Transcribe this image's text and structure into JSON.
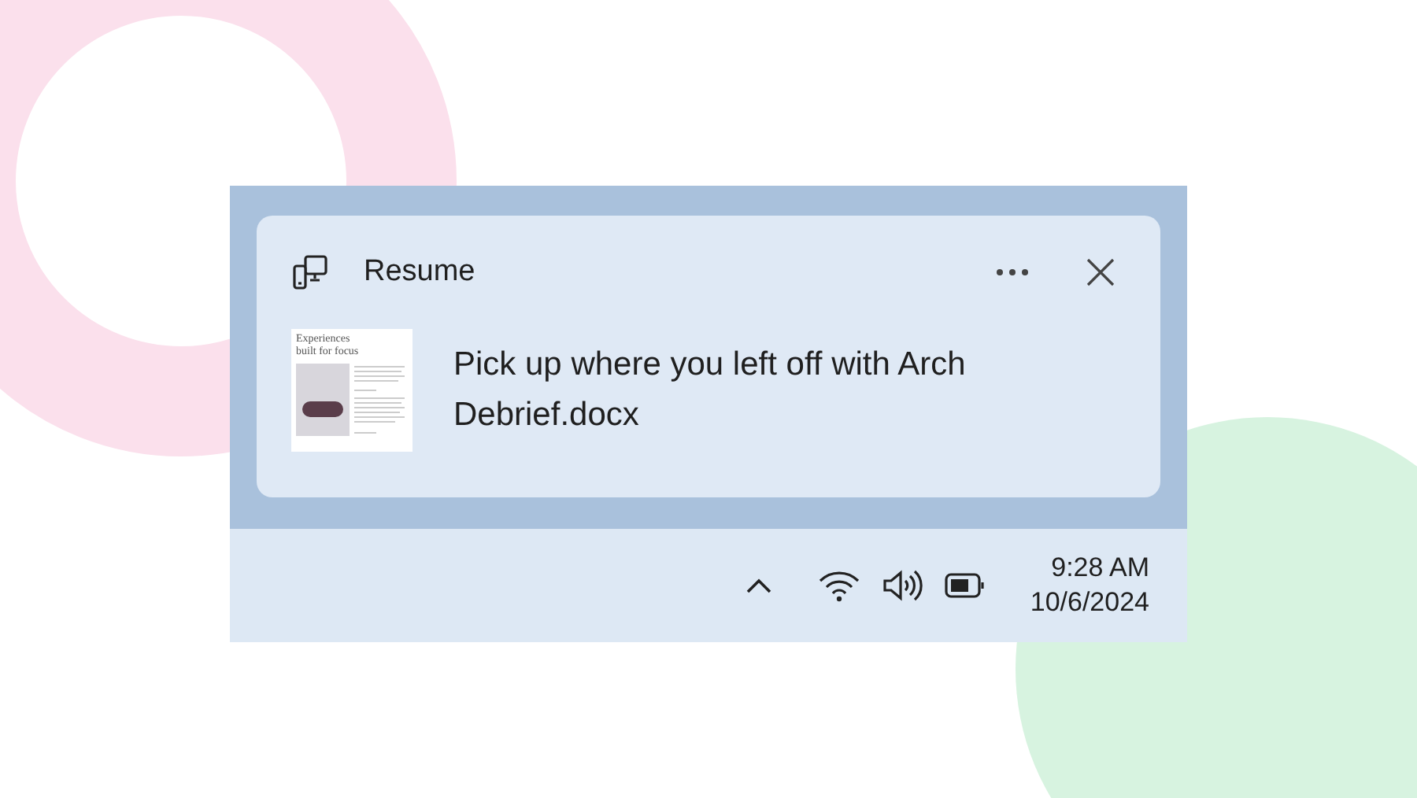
{
  "notification": {
    "app_name": "Resume",
    "message": "Pick up where you left off with Arch Debrief.docx",
    "thumbnail_title": "Experiences built for focus"
  },
  "taskbar": {
    "time": "9:28 AM",
    "date": "10/6/2024"
  }
}
